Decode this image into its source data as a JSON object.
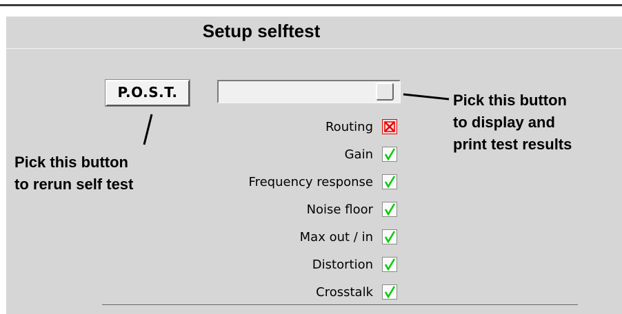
{
  "header": {
    "title": "Setup selftest"
  },
  "post_button": {
    "label": "P.O.S.T."
  },
  "callouts": {
    "left": [
      "Pick this button",
      "to rerun self test"
    ],
    "right": [
      "Pick this button",
      "to display and",
      "print test results"
    ]
  },
  "tests": [
    {
      "name": "Routing",
      "status": "fail",
      "icon": "x-mark-icon"
    },
    {
      "name": "Gain",
      "status": "pass",
      "icon": "check-mark-icon"
    },
    {
      "name": "Frequency response",
      "status": "pass",
      "icon": "check-mark-icon"
    },
    {
      "name": "Noise floor",
      "status": "pass",
      "icon": "check-mark-icon"
    },
    {
      "name": "Max out / in",
      "status": "pass",
      "icon": "check-mark-icon"
    },
    {
      "name": "Distortion",
      "status": "pass",
      "icon": "check-mark-icon"
    },
    {
      "name": "Crosstalk",
      "status": "pass",
      "icon": "check-mark-icon"
    }
  ],
  "colors": {
    "pass": "#00cc00",
    "fail": "#e00000",
    "panel": "#d6d6d6"
  }
}
